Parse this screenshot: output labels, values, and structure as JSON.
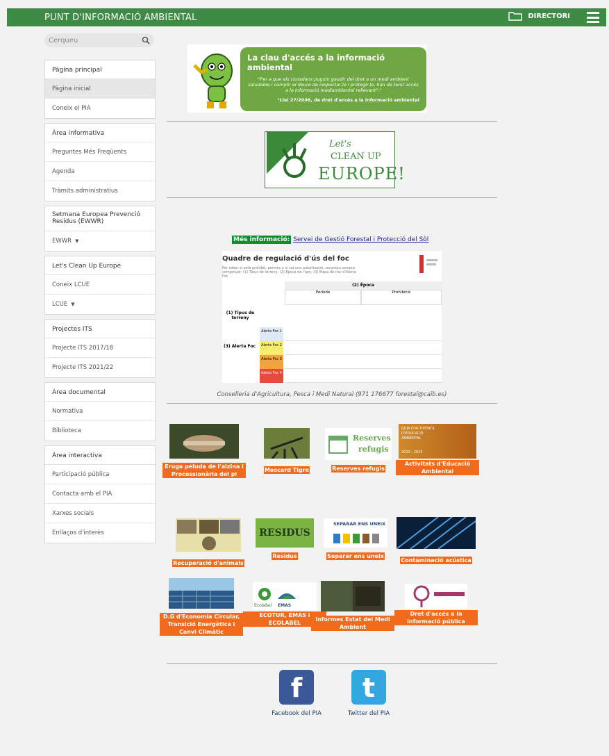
{
  "header": {
    "title": "PUNT D'INFORMACIÓ AMBIENTAL",
    "directory_label": "DIRECTORI"
  },
  "search": {
    "placeholder": "Cerqueu"
  },
  "sidebar": {
    "groups": [
      {
        "head": "Pàgina principal",
        "items": [
          "Pàgina inicial",
          "Coneix el PIA"
        ]
      },
      {
        "head": "Àrea informativa",
        "items": [
          "Preguntes Més Freqüents",
          "Agenda",
          "Tràmits administratius"
        ]
      },
      {
        "head": "Setmana Europea Prevenció Residus (EWWR)",
        "items": [
          "EWWR"
        ]
      },
      {
        "head": "Let's Clean Up Europe",
        "items": [
          "Coneix LCUE",
          "LCUE"
        ]
      },
      {
        "head": "Projectes ITS",
        "items": [
          "Projecte ITS 2017/18",
          "Projecte ITS 2021/22"
        ]
      },
      {
        "head": "Àrea documental",
        "items": [
          "Normativa",
          "Biblioteca"
        ]
      },
      {
        "head": "Àrea interactiva",
        "items": [
          "Participació pública",
          "Contacta amb el PIA",
          "Xarxes socials",
          "Enllaços d'interès"
        ]
      }
    ]
  },
  "banner": {
    "heading": "La clau d'accés a la informació ambiental",
    "quote": "\"Per a que els ciutadans puguin gaudir del dret a un medi ambient saludable i complir el deure de respectar-lo i protegir-lo, han de tenir accés a la informació mediambiental rellevant\".¹",
    "source": "¹Llei 27/2006, de dret d'accés a la informació ambiental"
  },
  "lcue": {
    "line1": "Let's",
    "line2": "CLEAN UP",
    "line3": "EUROPE!"
  },
  "more_info": {
    "tag": "Més informació:",
    "link": "Servei de Gestió Forestal i Protecció del Sòl"
  },
  "fire": {
    "title": "Quadre de regulació d'ús del foc",
    "subtitle": "Per saber si està prohibit, permès o si cal una autorització, recordau sempre comprovar: (1) Tipus de terreny, (2) Època de l'any, (3) Mapa de risc d'Alerta Foc",
    "col_header": "(2) Època",
    "row_header": "(1) Tipus de terreny",
    "alert_header": "(3) Alerta Foc",
    "period_a": "Període",
    "period_b": "Prohibició",
    "levels": [
      "Alerta Foc 1",
      "Alerta Foc 2",
      "Alerta Foc 3",
      "Alerta Foc 4"
    ]
  },
  "contact_line": "Conselleria d'Agricultura, Pesca i Medi Natural (971 176677 forestal@caib.es)",
  "tiles": [
    {
      "label": "Eruga peluda de l'alzina i Processionària del pi"
    },
    {
      "label": "Moscard Tigre"
    },
    {
      "label": "Reserves refugis",
      "image_text": [
        "Reserves",
        "refugis"
      ]
    },
    {
      "label": "Activitats d'Educació Ambiental",
      "image_text": [
        "GUIA D'ACTIVITATS",
        "D'EDUCACIÓ",
        "AMBIENTAL",
        "2022 - 2023"
      ]
    },
    {
      "label": "Recuperació d'animals"
    },
    {
      "label": "Residus",
      "image_text": [
        "RESIDUS"
      ]
    },
    {
      "label": "Separar ens uneix",
      "image_text": [
        "SEPARAR ENS UNEIX"
      ]
    },
    {
      "label": "Contaminació acústica"
    },
    {
      "label": "D.G d'Economia Circular, Transició Energètica i Canvi Climàtic"
    },
    {
      "label": "ECOTUR, EMAS i ECOLABEL",
      "image_text": [
        "Ecolabel",
        "EMAS"
      ]
    },
    {
      "label": "Informes Estat del Medi Ambient"
    },
    {
      "label": "Dret d'accés a la informació pública"
    }
  ],
  "social": [
    {
      "label": "Facebook del PIA",
      "color": "#3b5998",
      "glyph": "f"
    },
    {
      "label": "Twitter del PIA",
      "color": "#33a8e0",
      "glyph": "t"
    }
  ],
  "colors": {
    "header_green": "#3e8b46",
    "tile_orange": "#f26b1d",
    "banner_green": "#6fa842"
  }
}
